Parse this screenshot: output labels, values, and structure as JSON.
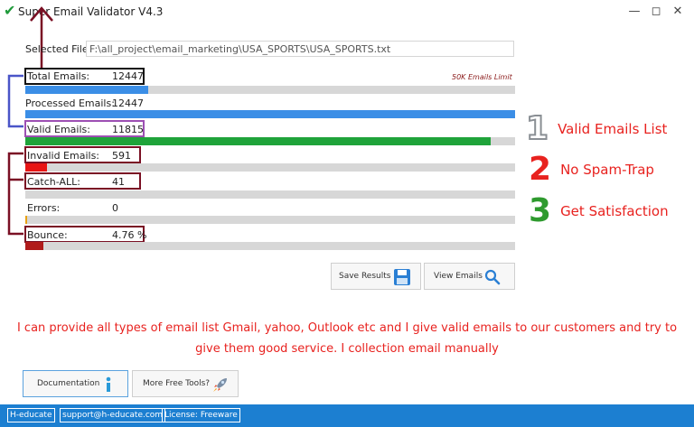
{
  "window": {
    "title": "Super Email Validator V4.3"
  },
  "form": {
    "selected_file_label": "Selected File:",
    "selected_file_value": "F:\\all_project\\email_marketing\\USA_SPORTS\\USA_SPORTS.txt",
    "limit_note": "50K Emails Limit"
  },
  "stats": {
    "total": {
      "label": "Total Emails:",
      "value": "12447",
      "progress": 0.25,
      "color": "#3b8ee6"
    },
    "processed": {
      "label": "Processed Emails:",
      "value": "12447",
      "progress": 1.0,
      "color": "#3b8ee6"
    },
    "valid": {
      "label": "Valid Emails:",
      "value": "11815",
      "progress": 0.95,
      "color": "#1fa33a"
    },
    "invalid": {
      "label": "Invalid Emails:",
      "value": "591",
      "progress": 0.045,
      "color": "#e81414"
    },
    "catchall": {
      "label": "Catch-ALL:",
      "value": "41",
      "progress": 0.0,
      "color": "#e81414"
    },
    "errors": {
      "label": "Errors:",
      "value": "0",
      "progress": 0.003,
      "color": "#e8a214"
    },
    "bounce": {
      "label": "Bounce:",
      "value": "4.76 %",
      "progress": 0.037,
      "color": "#b01b1b"
    }
  },
  "side_points": [
    {
      "number": "1",
      "text": "Valid Emails List",
      "color": "#9aa0a6"
    },
    {
      "number": "2",
      "text": "No Spam-Trap",
      "color": "#e8221f"
    },
    {
      "number": "3",
      "text": "Get Satisfaction",
      "color": "#2e9a2e"
    }
  ],
  "actions": {
    "save_results": "Save Results",
    "view_emails": "View Emails"
  },
  "promo_text": "I can provide all types of email list Gmail, yahoo, Outlook etc and I give valid emails to our customers and try to give them good service. I collection email manually",
  "bottom_buttons": {
    "documentation": "Documentation",
    "more_tools": "More Free Tools?"
  },
  "statusbar": {
    "brand": "H-educate",
    "email": "support@h-educate.com",
    "license": "License: Freeware"
  },
  "colors": {
    "annotation_dark_red": "#7a1024",
    "annotation_blue": "#4a55c8",
    "annotation_purple": "#9d4fb3",
    "statusbar_blue": "#1c7fd1"
  }
}
